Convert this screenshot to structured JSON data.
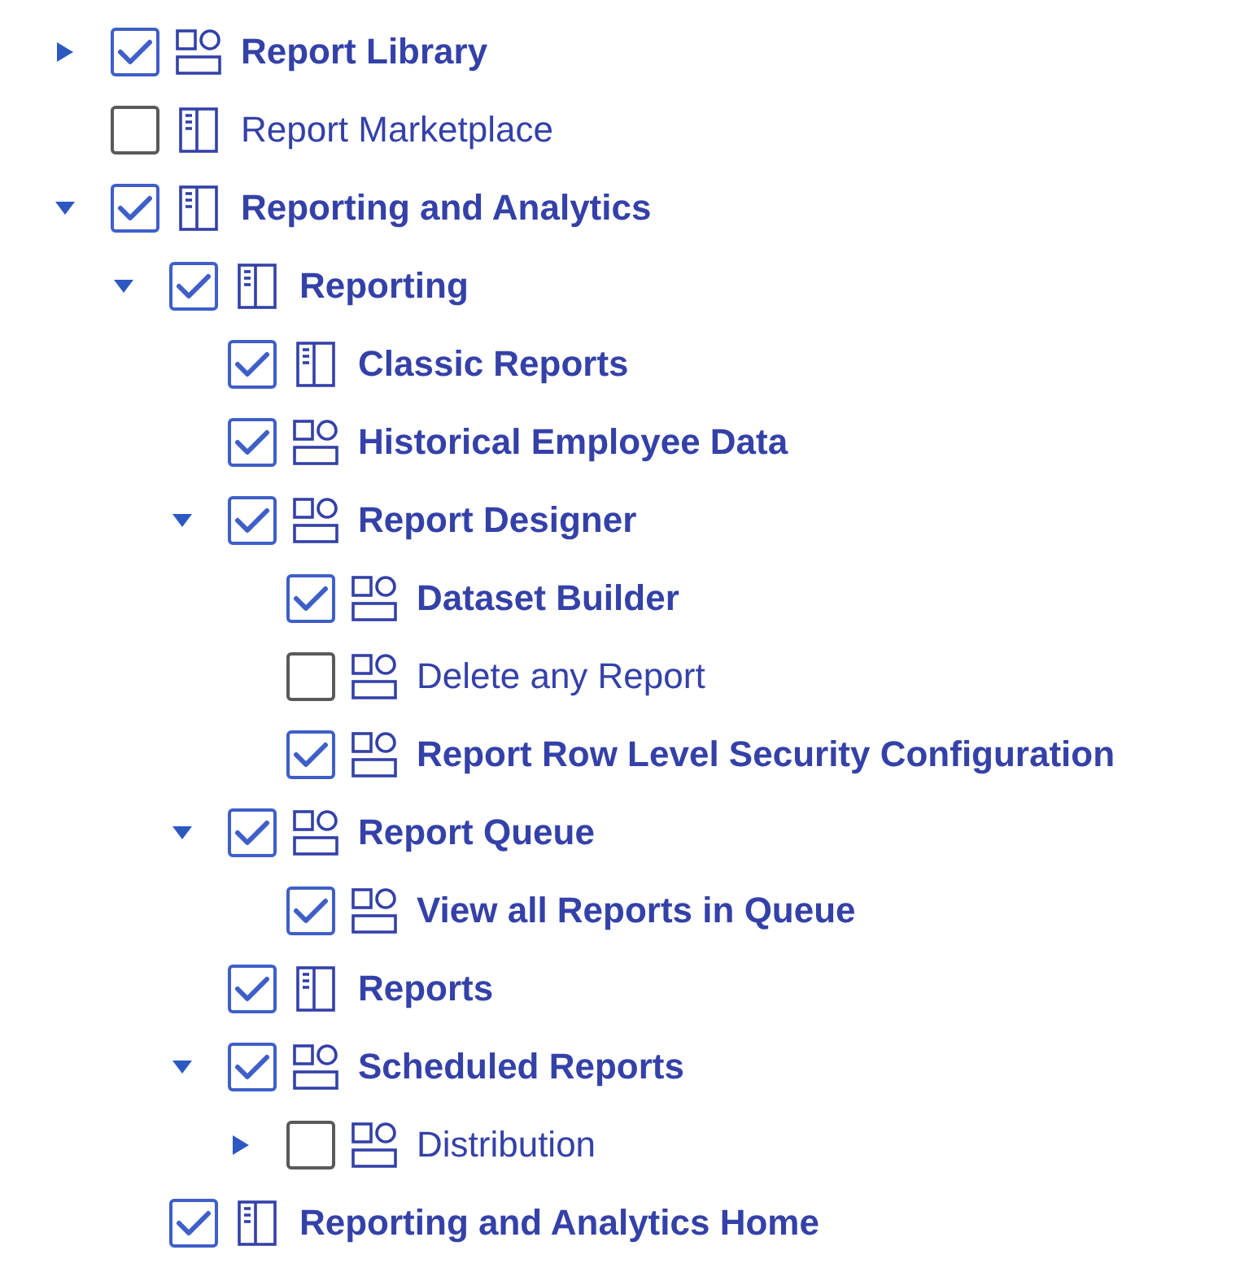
{
  "tree": [
    {
      "label": "Report Library",
      "checked": true,
      "kind": "group",
      "expanded": false
    },
    {
      "label": "Report Marketplace",
      "checked": false,
      "kind": "page"
    },
    {
      "label": "Reporting and Analytics",
      "checked": true,
      "kind": "page",
      "expanded": true,
      "children": [
        {
          "label": "Reporting",
          "checked": true,
          "kind": "page",
          "expanded": true,
          "children": [
            {
              "label": "Classic Reports",
              "checked": true,
              "kind": "page"
            },
            {
              "label": "Historical Employee Data",
              "checked": true,
              "kind": "group"
            },
            {
              "label": "Report Designer",
              "checked": true,
              "kind": "group",
              "expanded": true,
              "children": [
                {
                  "label": "Dataset Builder",
                  "checked": true,
                  "kind": "group"
                },
                {
                  "label": "Delete any Report",
                  "checked": false,
                  "kind": "group"
                },
                {
                  "label": "Report Row Level Security Configuration",
                  "checked": true,
                  "kind": "group"
                }
              ]
            },
            {
              "label": "Report Queue",
              "checked": true,
              "kind": "group",
              "expanded": true,
              "children": [
                {
                  "label": "View all Reports in Queue",
                  "checked": true,
                  "kind": "group"
                }
              ]
            },
            {
              "label": "Reports",
              "checked": true,
              "kind": "page"
            },
            {
              "label": "Scheduled Reports",
              "checked": true,
              "kind": "group",
              "expanded": true,
              "children": [
                {
                  "label": "Distribution",
                  "checked": false,
                  "kind": "group",
                  "expanded": false
                }
              ]
            }
          ]
        },
        {
          "label": "Reporting and Analytics Home",
          "checked": true,
          "kind": "page"
        }
      ]
    }
  ]
}
